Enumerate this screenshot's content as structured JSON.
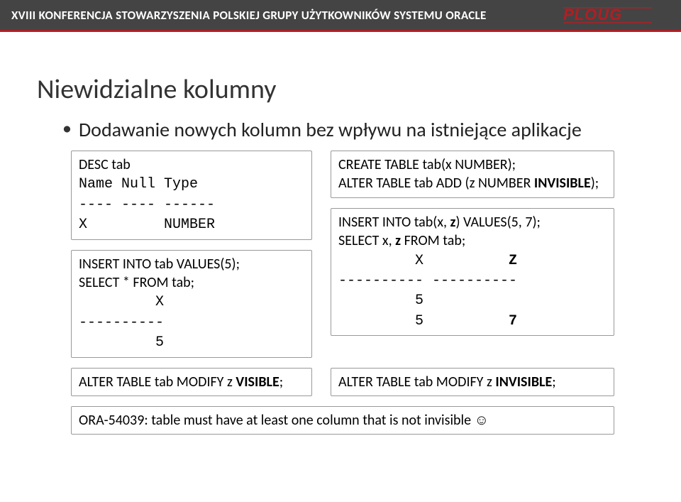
{
  "header": {
    "title": "XVIII KONFERENCJA STOWARZYSZENIA POLSKIEJ  GRUPY UŻYTKOWNIKÓW SYSTEMU ORACLE",
    "logo_text": "PLOUG"
  },
  "slide": {
    "title": "Niewidzialne kolumny",
    "bullet": "Dodawanie nowych kolumn bez wpływu na istniejące aplikacje"
  },
  "boxes": {
    "desc_tab": "DESC tab\nName Null Type\n---- ---- ------\nX         NUMBER",
    "create_table": "CREATE TABLE tab(x NUMBER);\nALTER TABLE tab ADD (z NUMBER INVISIBLE);",
    "insert_select_left": "INSERT INTO tab VALUES(5);\nSELECT * FROM tab;\n         X\n----------\n         5",
    "insert_select_right": "INSERT INTO tab(x, z) VALUES(5, 7);\nSELECT x, z FROM tab;\n         X          Z\n---------- ----------\n         5\n         5          7",
    "modify_visible": "ALTER TABLE tab MODIFY z VISIBLE;",
    "modify_invisible": "ALTER TABLE tab MODIFY z INVISIBLE;",
    "error": "ORA-54039: table must have at least one column that is not invisible ☺"
  }
}
